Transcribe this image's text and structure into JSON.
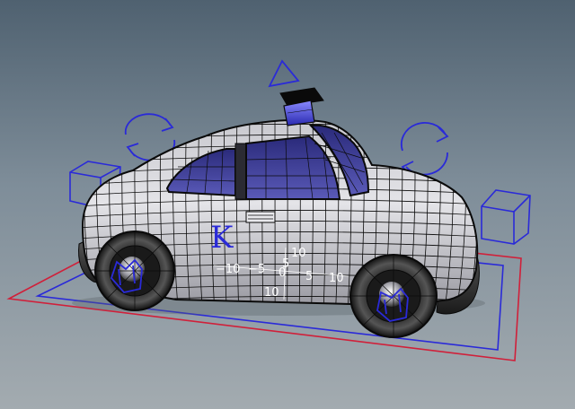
{
  "viewport": {
    "background_top": "#4f6170",
    "background_bottom": "#a3abb0",
    "wire_color": "#0a0a0a",
    "manipulator_color": "#2a2ad8",
    "ground_outer_color": "#d0203a",
    "ground_inner_color": "#2a2ad8"
  },
  "controls": {
    "k_label": "K",
    "icons": [
      "triangle-up-icon",
      "rotate-icon",
      "rotate-icon",
      "cube-icon",
      "cube-icon",
      "wheel-control-icon",
      "wheel-control-icon"
    ]
  },
  "ruler": {
    "x_ticks": [
      "−10",
      "−5",
      "0",
      "5",
      "10"
    ],
    "y_ticks": [
      "10",
      "5",
      "10"
    ]
  }
}
